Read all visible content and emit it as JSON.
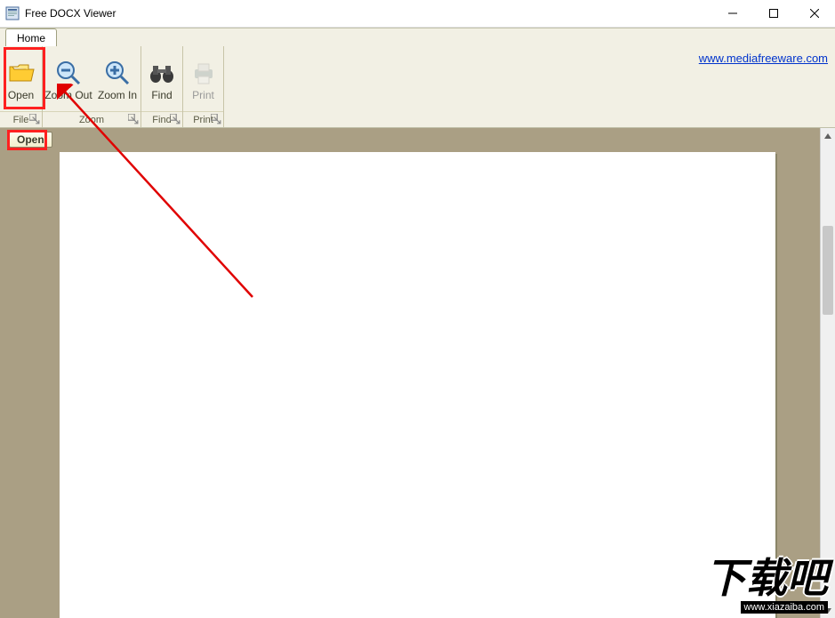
{
  "window": {
    "title": "Free DOCX Viewer"
  },
  "tabs": {
    "home": "Home"
  },
  "ribbon": {
    "open": "Open",
    "zoom_out": "Zoom Out",
    "zoom_in": "Zoom In",
    "find": "Find",
    "print": "Print",
    "group_file": "File",
    "group_zoom": "Zoom",
    "group_find": "Find",
    "group_print": "Print",
    "url": "www.mediafreeware.com"
  },
  "tooltip": {
    "open": "Open"
  },
  "watermark": {
    "cn": "下载吧",
    "url": "www.xiazaiba.com"
  }
}
